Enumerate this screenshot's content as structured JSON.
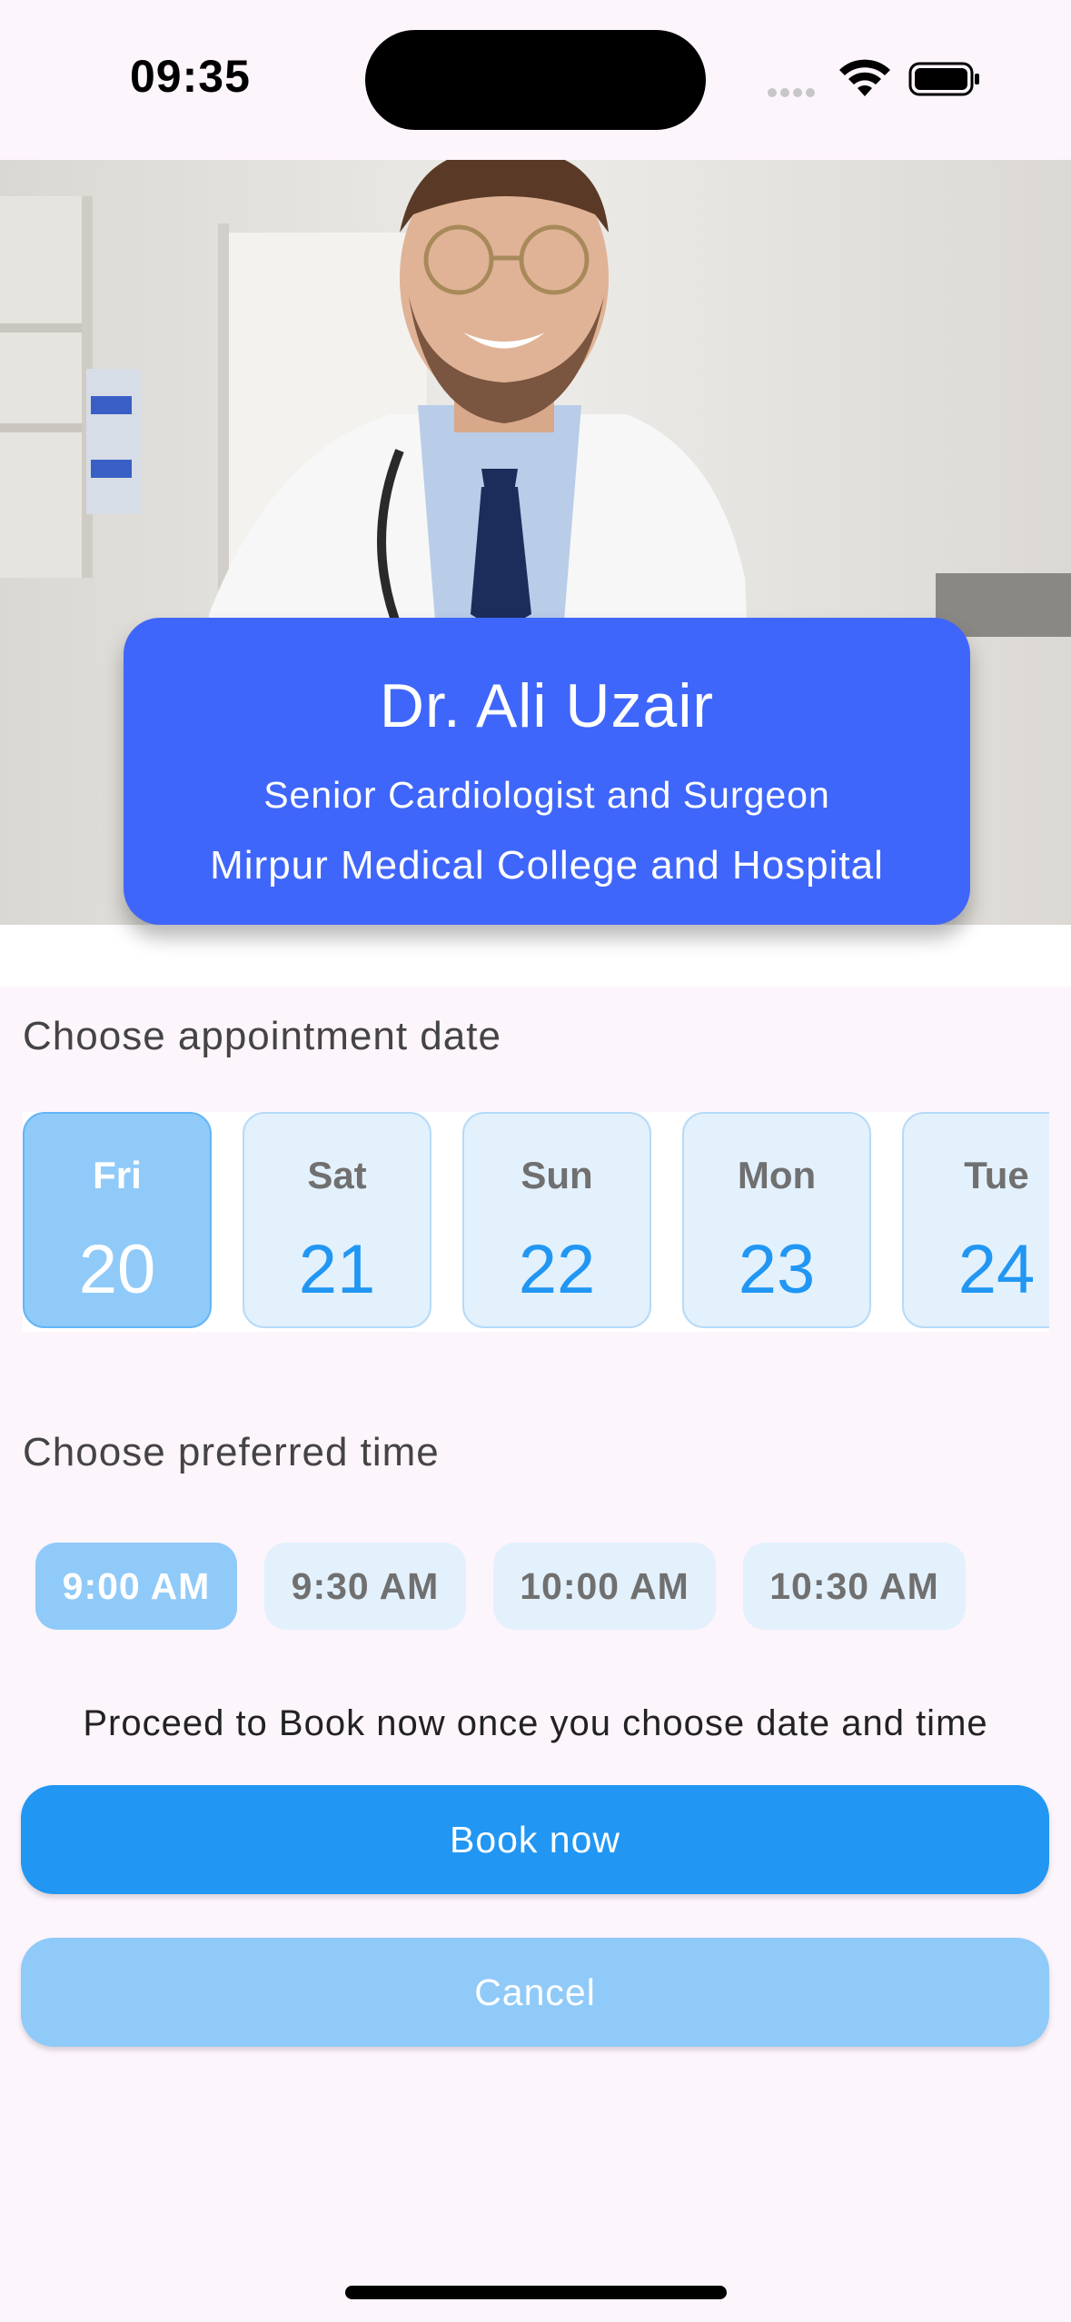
{
  "status_bar": {
    "time": "09:35"
  },
  "doctor": {
    "name": "Dr. Ali Uzair",
    "title": "Senior Cardiologist and Surgeon",
    "hospital": "Mirpur Medical College and Hospital"
  },
  "date_section": {
    "label": "Choose appointment date",
    "dates": [
      {
        "day": "Fri",
        "num": "20",
        "selected": true
      },
      {
        "day": "Sat",
        "num": "21",
        "selected": false
      },
      {
        "day": "Sun",
        "num": "22",
        "selected": false
      },
      {
        "day": "Mon",
        "num": "23",
        "selected": false
      },
      {
        "day": "Tue",
        "num": "24",
        "selected": false
      }
    ]
  },
  "time_section": {
    "label": "Choose preferred time",
    "slots": [
      {
        "label": "9:00 AM",
        "selected": true
      },
      {
        "label": "9:30 AM",
        "selected": false
      },
      {
        "label": "10:00 AM",
        "selected": false
      },
      {
        "label": "10:30 AM",
        "selected": false
      }
    ]
  },
  "hint": "Proceed to Book now once you choose date and time",
  "actions": {
    "book_label": "Book now",
    "cancel_label": "Cancel"
  },
  "colors": {
    "card": "#3f66fa",
    "primary": "#2196f3",
    "selected": "#90caf9",
    "tile_bg": "#e3f1fd",
    "background": "#fdf5fc"
  }
}
